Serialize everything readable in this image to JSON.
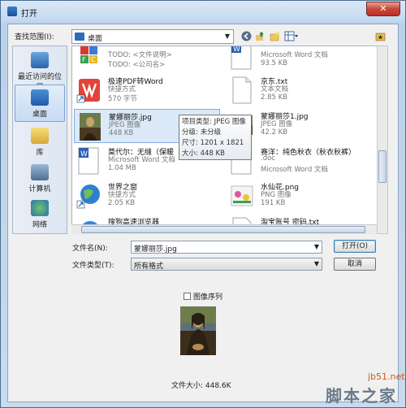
{
  "window": {
    "title": "打开",
    "close_glyph": "✕"
  },
  "lookin": {
    "label": "查找范围(I):",
    "value": "桌面"
  },
  "places": [
    {
      "label": "最近访问的位置",
      "icon": "recent-places-icon"
    },
    {
      "label": "桌面",
      "icon": "desktop-icon",
      "active": true
    },
    {
      "label": "库",
      "icon": "library-icon"
    },
    {
      "label": "计算机",
      "icon": "computer-icon"
    },
    {
      "label": "网络",
      "icon": "network-icon"
    }
  ],
  "files": [
    {
      "name": "",
      "line1": "TODO: <文件说明>",
      "line2": "TODO: <公司名>",
      "icon": "mfc-app-icon"
    },
    {
      "name": "",
      "line1": "Microsoft Word 文档",
      "line2": "93.5 KB",
      "icon": "word-doc-icon"
    },
    {
      "name": "极速PDF转Word",
      "line1": "快捷方式",
      "line2": "570 字节",
      "icon": "pdf-word-icon"
    },
    {
      "name": "京东.txt",
      "line1": "文本文档",
      "line2": "2.85 KB",
      "icon": "text-doc-icon"
    },
    {
      "name": "蒙娜丽莎.jpg",
      "line1": "JPEG 图像",
      "line2": "448 KB",
      "icon": "jpeg-thumb-icon",
      "selected": true
    },
    {
      "name": "蒙娜丽莎1.jpg",
      "line1": "JPEG 图像",
      "line2": "42.2 KB",
      "icon": "jpeg-thumb-icon"
    },
    {
      "name": "莫代尔：无缝（保暖",
      "line1": "Microsoft Word 文档",
      "line2": "1.04 MB",
      "icon": "word-doc-icon"
    },
    {
      "name": "赛洋：纯色秋衣（秋衣秋裤）",
      "line1": ".doc",
      "line2": "Microsoft Word 文档",
      "icon": "word-doc-icon"
    },
    {
      "name": "世界之窗",
      "line1": "快捷方式",
      "line2": "2.05 KB",
      "icon": "globe-shortcut-icon"
    },
    {
      "name": "水仙花.png",
      "line1": "PNG 图像",
      "line2": "191 KB",
      "icon": "png-thumb-icon"
    },
    {
      "name": "搜狗高速浏览器",
      "line1": "",
      "line2": "",
      "icon": "sogou-browser-icon"
    },
    {
      "name": "淘宝账号 密码.txt",
      "line1": "",
      "line2": "",
      "icon": "text-doc-icon"
    }
  ],
  "tooltip": {
    "type": "项目类型: JPEG 图像",
    "rating": "分级: 未分级",
    "dims": "尺寸: 1201 x 1821",
    "size": "大小: 448 KB"
  },
  "form": {
    "filename_label": "文件名(N):",
    "filename_value": "蒙娜丽莎.jpg",
    "filetype_label": "文件类型(T):",
    "filetype_value": "所有格式",
    "open_button": "打开(O)",
    "cancel_button": "取消"
  },
  "preview": {
    "sequence_label": "图像序列",
    "file_size": "文件大小: 448.6K"
  },
  "watermark": {
    "site": "jb51.net",
    "brand": "脚本之家"
  },
  "colors": {
    "selection": "#dbe9f8",
    "accent": "#3c7fb1"
  }
}
